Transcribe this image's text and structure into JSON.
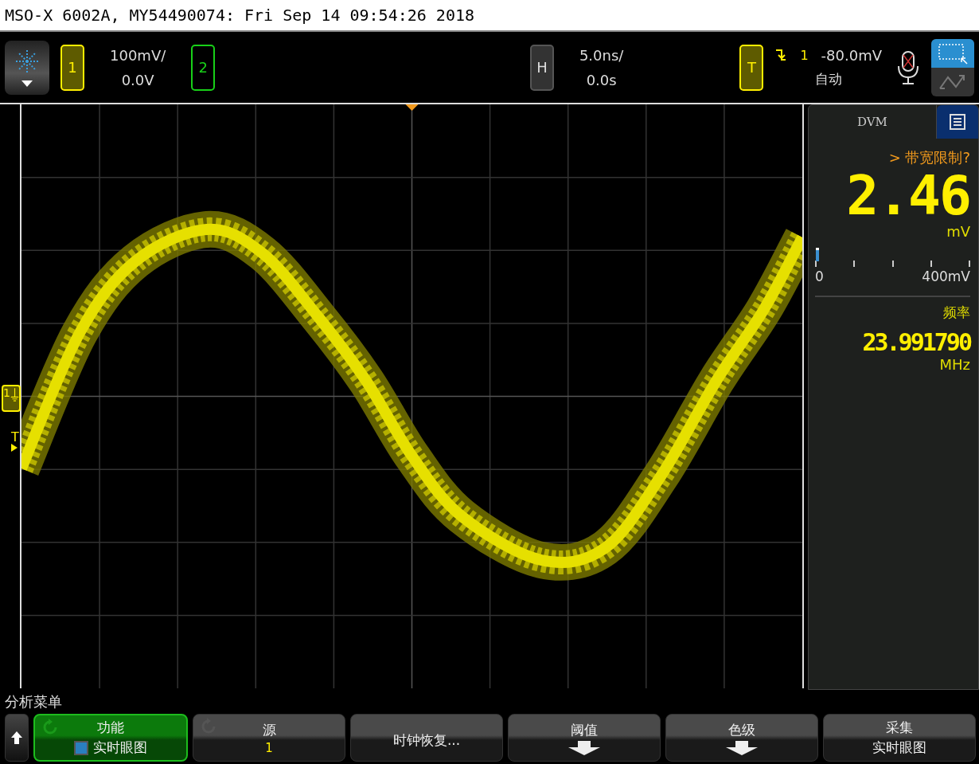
{
  "window": {
    "title": "MSO-X 6002A, MY54490074: Fri Sep 14 09:54:26 2018"
  },
  "channels": [
    {
      "label": "1",
      "on": true,
      "scale": "100mV/",
      "offset": "0.0V"
    },
    {
      "label": "2",
      "on": false
    }
  ],
  "horizontal": {
    "label": "H",
    "scale": "5.0ns/",
    "delay": "0.0s"
  },
  "trigger": {
    "label": "T",
    "source": "1",
    "level": "-80.0mV",
    "mode": "自动"
  },
  "markers": {
    "channel": "1",
    "trigger": "T"
  },
  "dvm": {
    "title": "DVM",
    "warning": "> 带宽限制?",
    "reading": "2.46",
    "unit": "mV",
    "meter": {
      "level": 0.006,
      "min": "0",
      "max": "400mV"
    },
    "freq_label": "频率",
    "freq": "23.991790",
    "freq_unit": "MHz"
  },
  "menu": {
    "title": "分析菜单",
    "buttons": [
      {
        "kind": "function",
        "selected": true,
        "label": "功能",
        "value": "实时眼图"
      },
      {
        "kind": "value",
        "selected": false,
        "label": "源",
        "value": "1"
      },
      {
        "kind": "plain",
        "selected": false,
        "label": "时钟恢复..."
      },
      {
        "kind": "submenu",
        "selected": false,
        "label": "阈值"
      },
      {
        "kind": "submenu",
        "selected": false,
        "label": "色级"
      },
      {
        "kind": "text",
        "selected": false,
        "label": "采集",
        "value": "实时眼图"
      }
    ]
  }
}
